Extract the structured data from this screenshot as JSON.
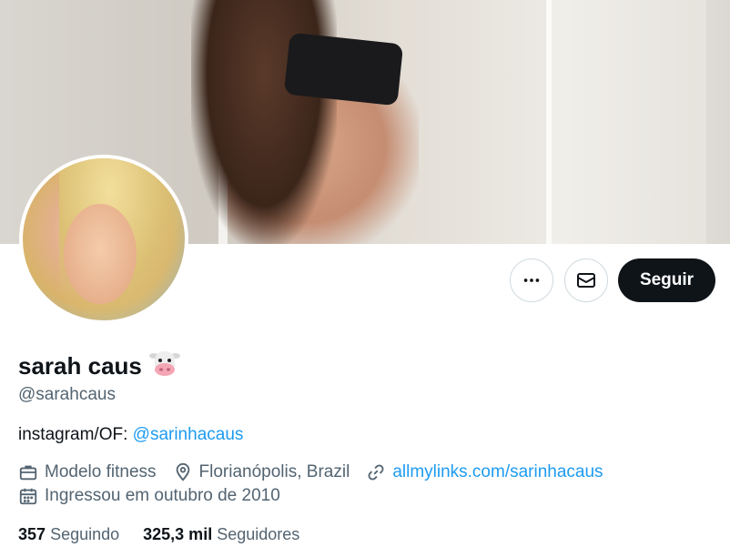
{
  "profile": {
    "name": "sarah caus",
    "handle": "@sarahcaus",
    "bio_prefix": "instagram/OF: ",
    "bio_mention": "@sarinhacaus",
    "occupation": "Modelo fitness",
    "location": "Florianópolis, Brazil",
    "website": "allmylinks.com/sarinhacaus",
    "joined": "Ingressou em outubro de 2010"
  },
  "actions": {
    "follow_label": "Seguir",
    "more_icon": "more-horizontal-icon",
    "message_icon": "envelope-icon"
  },
  "stats": {
    "following_count": "357",
    "following_label": "Seguindo",
    "followers_count": "325,3 mil",
    "followers_label": "Seguidores"
  },
  "colors": {
    "accent": "#1d9bf0",
    "primary_text": "#0f1419",
    "secondary_text": "#536471",
    "border": "#cfd9de"
  }
}
